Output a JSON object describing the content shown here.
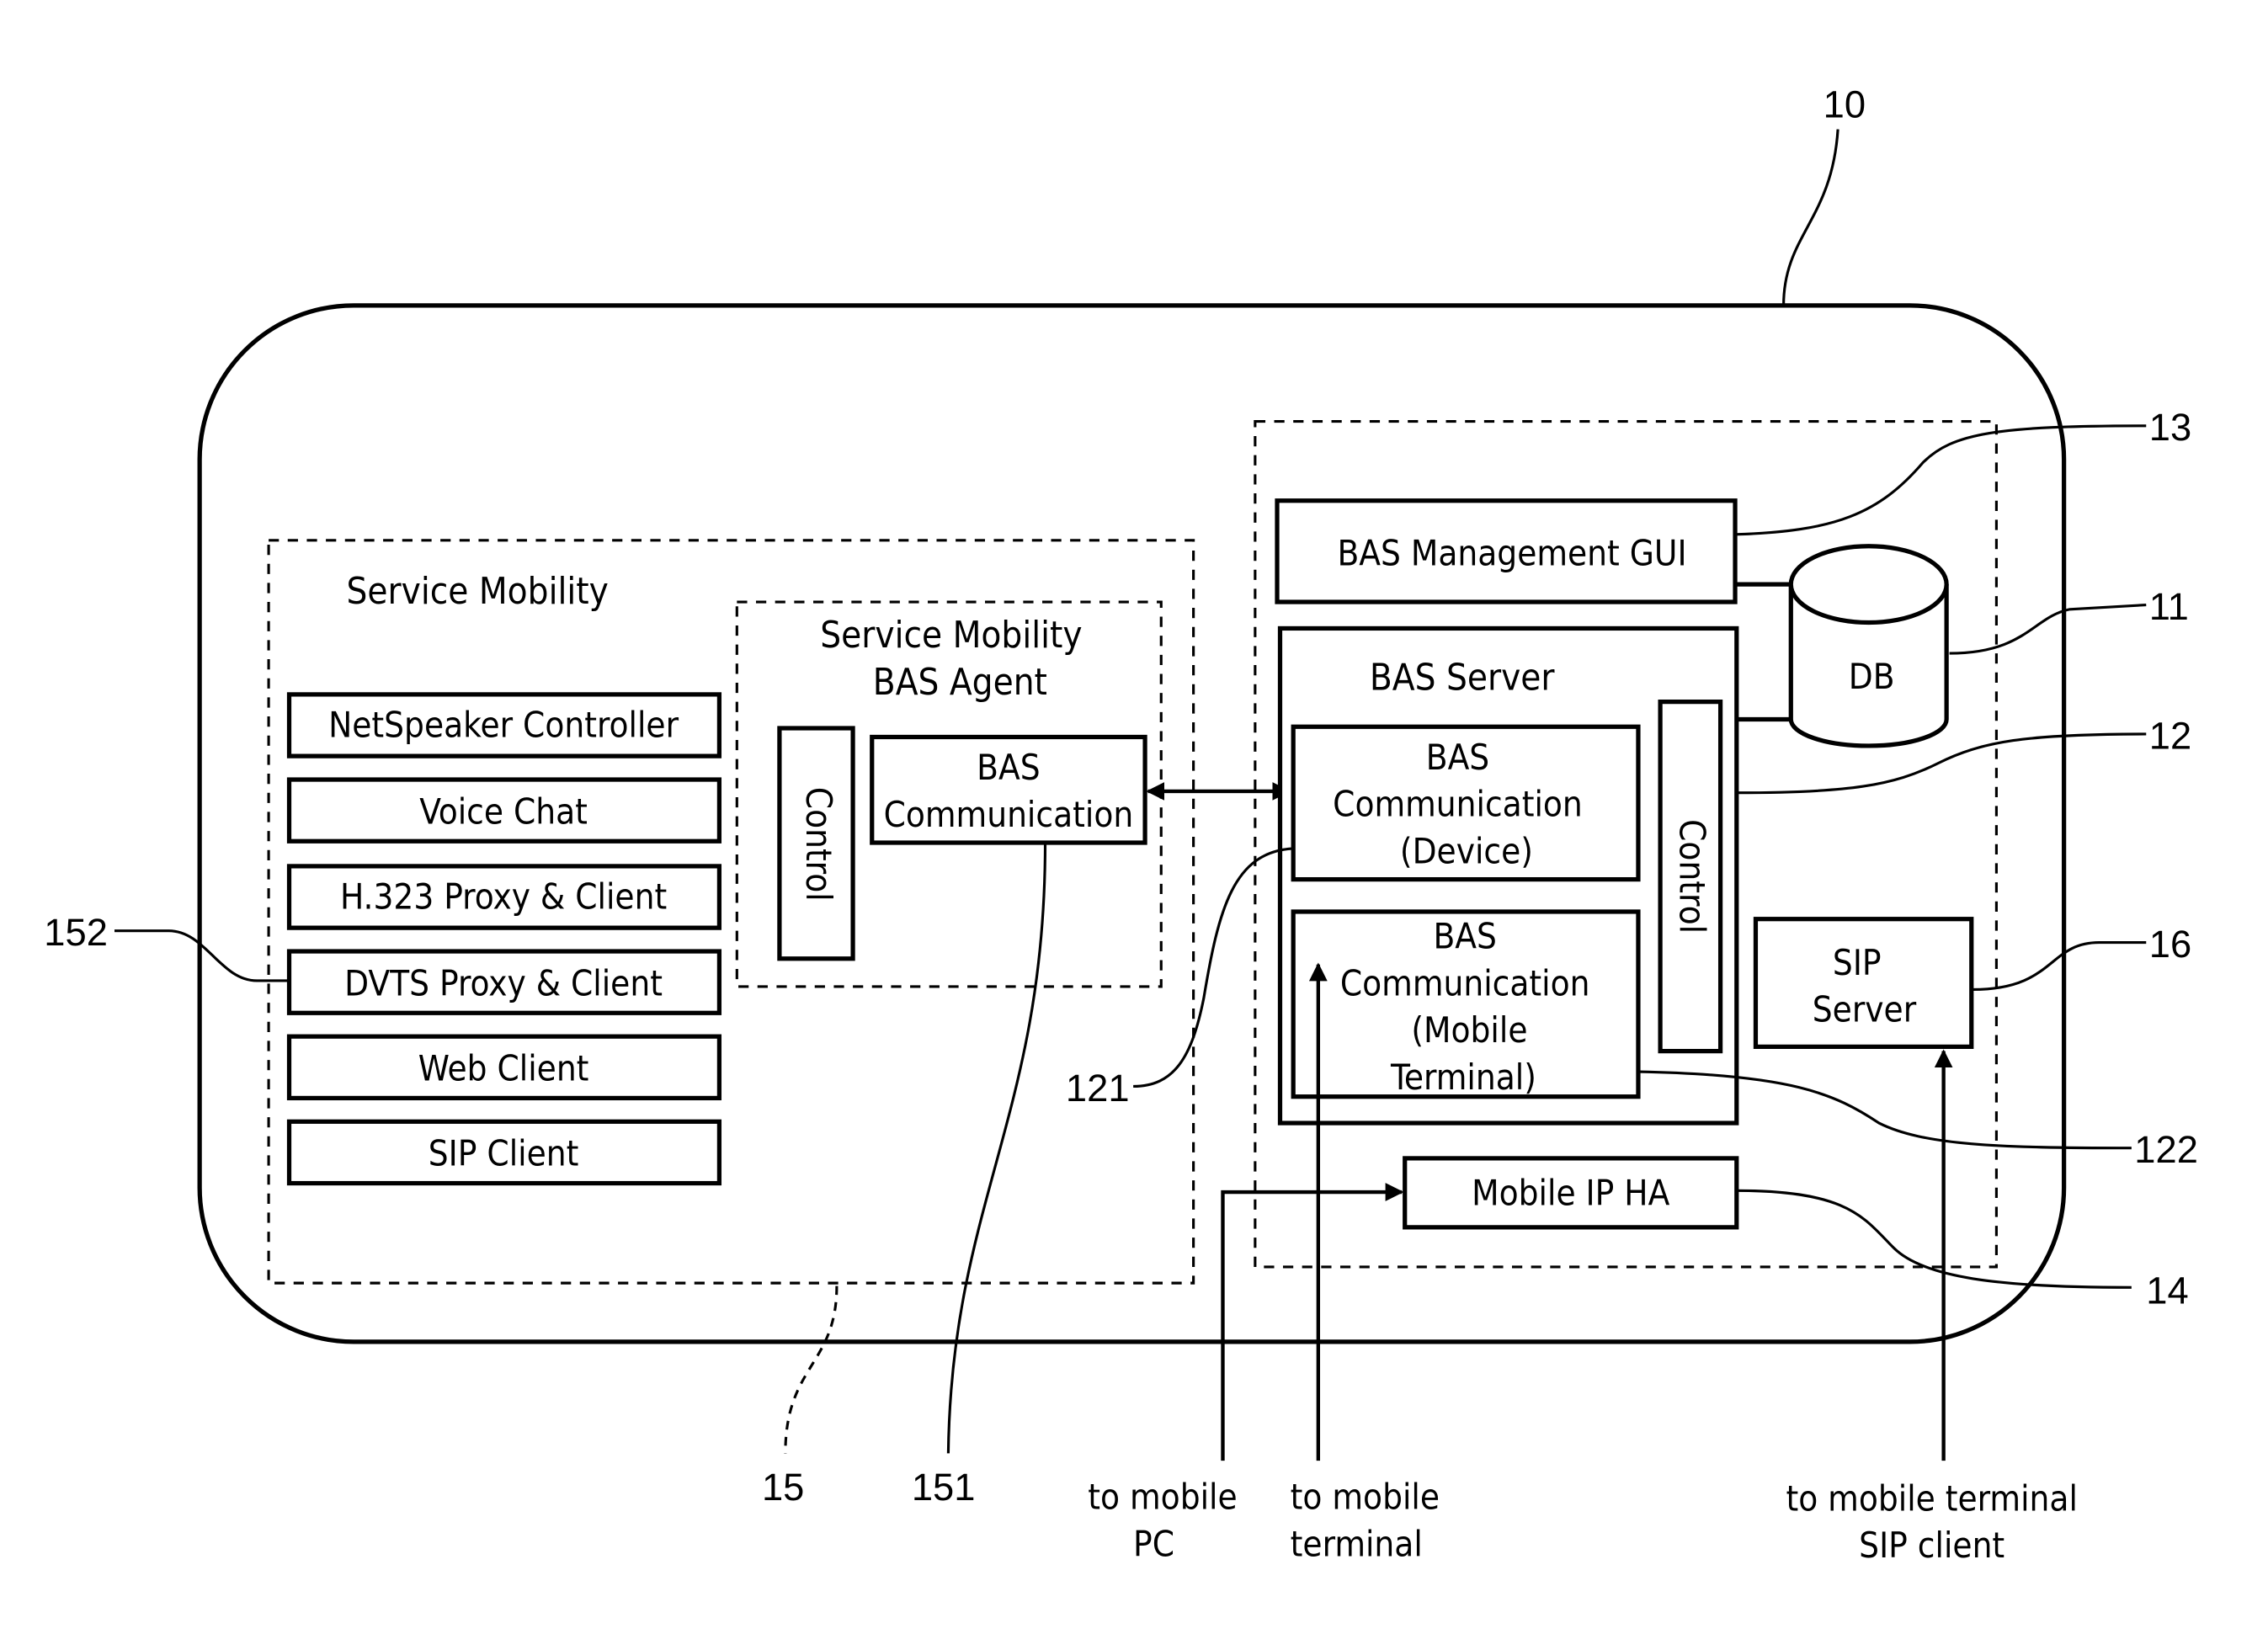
{
  "diagram": {
    "ref_labels": {
      "system": "10",
      "db": "11",
      "bas_server": "12",
      "bas_management_gui": "13",
      "mobile_ip_ha": "14",
      "service_mobility": "15",
      "sip_server": "16",
      "bas_comm_device": "121",
      "bas_comm_mobile_terminal": "122",
      "bas_comm_agent": "151",
      "dvts_proxy": "152"
    },
    "service_mobility": {
      "title": "Service Mobility",
      "items": [
        "NetSpeaker Controller",
        "Voice Chat",
        "H.323 Proxy & Client",
        "DVTS Proxy & Client",
        "Web Client",
        "SIP Client"
      ],
      "agent": {
        "title_line1": "Service Mobility",
        "title_line2": "BAS Agent",
        "control": "Control",
        "comm_line1": "BAS",
        "comm_line2": "Communication"
      }
    },
    "server_side": {
      "management_gui": "BAS Management GUI",
      "db": "DB",
      "bas_server": {
        "title": "BAS Server",
        "control": "Control",
        "comm_device": [
          "BAS",
          "Communication",
          "(Device)"
        ],
        "comm_mobile": [
          "BAS",
          "Communication",
          "(Mobile",
          "Terminal)"
        ]
      },
      "sip_server": [
        "SIP",
        "Server"
      ],
      "mobile_ip_ha": "Mobile IP HA"
    },
    "external": {
      "to_mobile_pc": [
        "to mobile",
        "PC"
      ],
      "to_mobile_terminal": [
        "to mobile",
        "terminal"
      ],
      "to_sip_client": [
        "to mobile terminal",
        "SIP client"
      ]
    }
  }
}
